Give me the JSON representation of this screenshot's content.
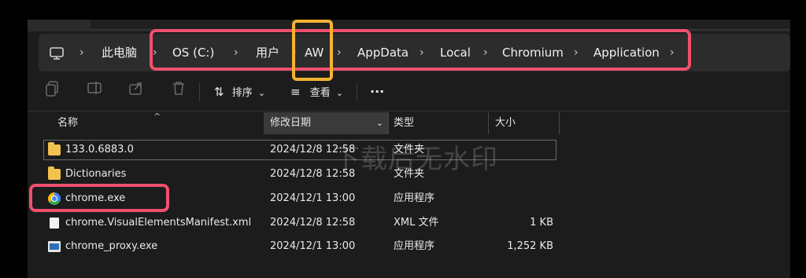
{
  "breadcrumb": {
    "items": [
      "此电脑",
      "OS (C:)",
      "用户",
      "AW",
      "AppData",
      "Local",
      "Chromium",
      "Application"
    ],
    "chevron": "›"
  },
  "toolbar": {
    "sort_label": "排序",
    "view_label": "查看",
    "more_label": "···",
    "sort_arrow": "⇅",
    "view_icon": "≡",
    "dropdown": "⌄"
  },
  "columns": {
    "name": "名称",
    "date": "修改日期",
    "type": "类型",
    "size": "大小",
    "sort_indicator": "^"
  },
  "files": [
    {
      "name": "133.0.6883.0",
      "date": "2024/12/8 12:58",
      "type": "文件夹",
      "size": "",
      "icon": "folder-icon"
    },
    {
      "name": "Dictionaries",
      "date": "2024/12/8 12:58",
      "type": "文件夹",
      "size": "",
      "icon": "folder-icon"
    },
    {
      "name": "chrome.exe",
      "date": "2024/12/1 13:00",
      "type": "应用程序",
      "size": "",
      "icon": "chrome-icon"
    },
    {
      "name": "chrome.VisualElementsManifest.xml",
      "date": "2024/12/8 12:58",
      "type": "XML 文件",
      "size": "1 KB",
      "icon": "xml-file-icon"
    },
    {
      "name": "chrome_proxy.exe",
      "date": "2024/12/1 13:00",
      "type": "应用程序",
      "size": "1,252 KB",
      "icon": "app-icon"
    }
  ],
  "watermark": "下载后无水印",
  "colors": {
    "highlight_red": "#f0506e",
    "highlight_yellow": "#f5b233",
    "folder": "#f2c14e"
  }
}
